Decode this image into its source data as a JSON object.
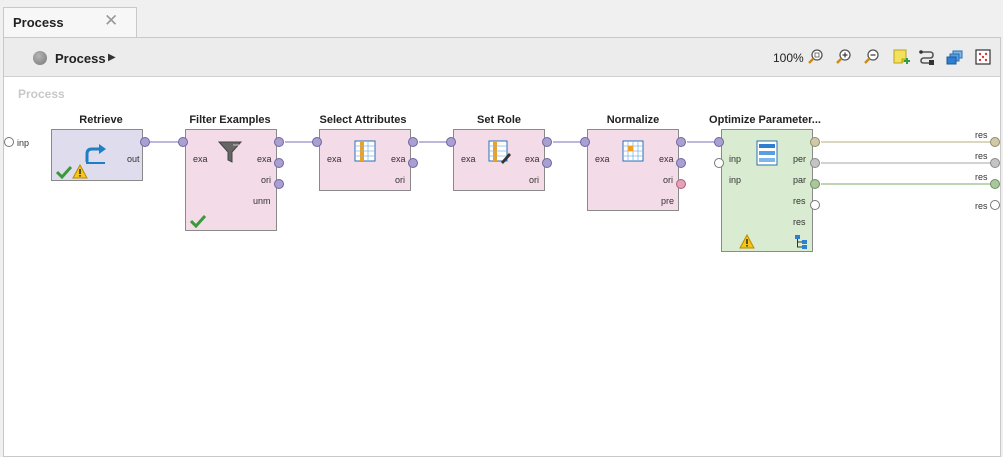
{
  "tab": {
    "label": "Process",
    "close": "✕"
  },
  "toolbar": {
    "breadcrumb": "Process",
    "arrow": "▶",
    "zoom": "100%"
  },
  "canvas": {
    "title": "Process"
  },
  "input_port_label": "inp",
  "operators": {
    "retrieve": {
      "title": "Retrieve",
      "out": "out"
    },
    "filter": {
      "title": "Filter Examples",
      "in": "exa",
      "out1": "exa",
      "out2": "ori",
      "out3": "unm"
    },
    "select": {
      "title": "Select Attributes",
      "in": "exa",
      "out1": "exa",
      "out2": "ori"
    },
    "setrole": {
      "title": "Set Role",
      "in": "exa",
      "out1": "exa",
      "out2": "ori"
    },
    "normalize": {
      "title": "Normalize",
      "in": "exa",
      "out1": "exa",
      "out2": "ori",
      "out3": "pre"
    },
    "optimize": {
      "title": "Optimize Parameter...",
      "in1": "inp",
      "in2": "inp",
      "out1": "per",
      "out2": "par",
      "out3": "res",
      "out4": "res"
    }
  },
  "result_ports": [
    "res",
    "res",
    "res",
    "res"
  ],
  "colors": {
    "retrieve_fill": "#dfdcee",
    "data_fill": "#f3dbe7",
    "optimize_fill": "#d9ebd1",
    "data_port": "#a99fd1",
    "perf_port": "#cfc9a8",
    "model_port": "#a9c79a",
    "pre_port": "#e7a0b7",
    "param_port": "#c4c4c4"
  }
}
